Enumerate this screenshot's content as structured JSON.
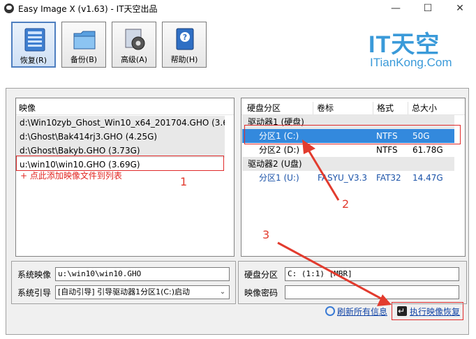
{
  "window": {
    "title": "Easy Image X (v1.63) - IT天空出品",
    "minimize": "—",
    "maximize": "☐",
    "close": "✕"
  },
  "toolbar": {
    "buttons": [
      {
        "label": "恢复(R)",
        "icon": "restore-icon"
      },
      {
        "label": "备份(B)",
        "icon": "backup-folder-icon"
      },
      {
        "label": "高级(A)",
        "icon": "advanced-gear-icon"
      },
      {
        "label": "帮助(H)",
        "icon": "help-book-icon"
      }
    ]
  },
  "logo": {
    "main": "IT天空",
    "sub": "ITianKong.Com"
  },
  "images_panel": {
    "header": "映像",
    "items": [
      "d:\\Win10zyb_Ghost_Win10_x64_201704.GHO (3.6...",
      "d:\\Ghost\\Bak414rj3.GHO (4.25G)",
      "d:\\Ghost\\Bakyb.GHO (3.73G)",
      "u:\\win10\\win10.GHO (3.69G)"
    ],
    "add_link": "+ 点此添加映像文件到列表"
  },
  "disk_panel": {
    "headers": [
      "硬盘分区",
      "卷标",
      "格式",
      "总大小"
    ],
    "rows": [
      {
        "type": "group",
        "partition": "驱动器1 (硬盘)",
        "label": "",
        "format": "",
        "size": ""
      },
      {
        "type": "selected",
        "partition": "分区1 (C:)",
        "label": "",
        "format": "NTFS",
        "size": "50G"
      },
      {
        "type": "normal",
        "partition": "分区2 (D:)",
        "label": "",
        "format": "NTFS",
        "size": "61.78G"
      },
      {
        "type": "group",
        "partition": "驱动器2 (U盘)",
        "label": "",
        "format": "",
        "size": ""
      },
      {
        "type": "blue",
        "partition": "分区1 (U:)",
        "label": "FASYU_V3.3",
        "format": "FAT32",
        "size": "14.47G"
      }
    ]
  },
  "annotations": {
    "n1": "1",
    "n2": "2",
    "n3": "3"
  },
  "bottom": {
    "system_image_label": "系统映像",
    "system_image_value": "u:\\win10\\win10.GHO",
    "system_boot_label": "系统引导",
    "system_boot_value": "[自动引导] 引导驱动器1分区1(C:)启动",
    "disk_partition_label": "硬盘分区",
    "disk_partition_value": "C: (1:1) [MBR]",
    "image_password_label": "映像密码",
    "image_password_value": "",
    "refresh_link": "刷新所有信息",
    "execute_link": "执行映像恢复"
  },
  "colors": {
    "accent": "#3389dd",
    "annotation_red": "#e23b2e",
    "link_blue": "#1346a8"
  }
}
